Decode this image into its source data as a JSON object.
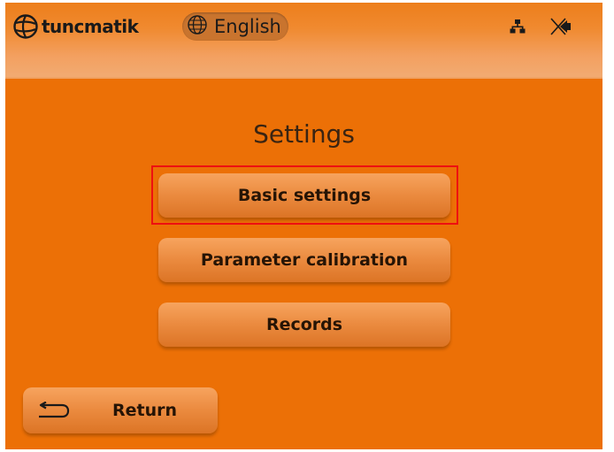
{
  "header": {
    "brand": "tuncmatik",
    "language": "English",
    "icons": [
      "network-icon",
      "mute-icon",
      "globe-icon",
      "logo-icon"
    ]
  },
  "main": {
    "title": "Settings",
    "menu": [
      {
        "label": "Basic settings",
        "selected": true
      },
      {
        "label": "Parameter calibration",
        "selected": false
      },
      {
        "label": "Records",
        "selected": false
      }
    ]
  },
  "footer": {
    "return_label": "Return",
    "return_icon": "return-arrow-icon"
  },
  "colors": {
    "background": "#ec7006",
    "button": "#eb8b40",
    "highlight": "#ee1010",
    "text": "#261405"
  }
}
